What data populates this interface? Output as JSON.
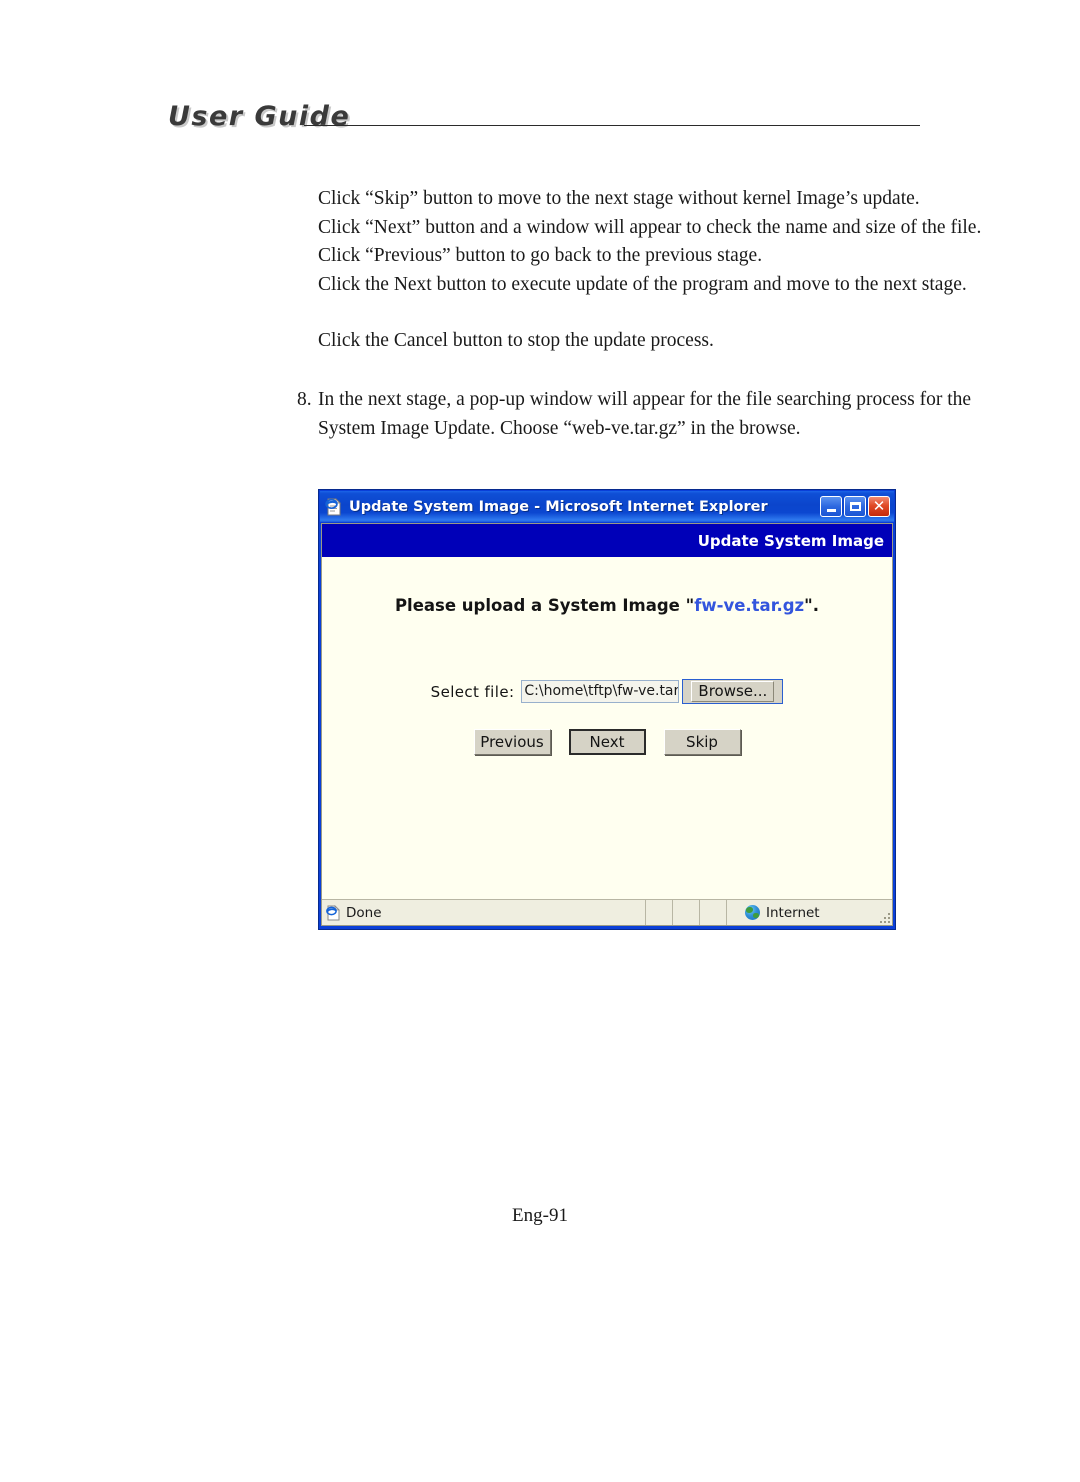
{
  "header": {
    "guide_title": "User Guide"
  },
  "body": {
    "paragraphs": [
      "Click “Skip” button to move to the next stage without kernel Image’s update.",
      "Click “Next” button and a window will appear to check the name and size of the file.",
      "Click “Previous” button to go back to the previous stage.",
      "Click the Next button to execute update of the program and move to the next stage.",
      "Click the Cancel button to stop the update process."
    ],
    "numbered_item": {
      "number": "8.",
      "line1": "In the next stage, a pop-up window will appear for the file searching process for the",
      "line2": "System Image Update. Choose “web-ve.tar.gz” in the browse."
    }
  },
  "browser": {
    "titlebar": {
      "icon": "ie-document-icon",
      "title": "Update System Image - Microsoft Internet Explorer",
      "minimize_label": "Minimize",
      "maximize_label": "Maximize",
      "close_label": "Close"
    },
    "app_bar": {
      "title": "Update System Image"
    },
    "content": {
      "heading_prefix": "Please upload a System Image \"",
      "heading_filename": "fw-ve.tar.gz",
      "heading_suffix": "\".",
      "file_label": "Select file:",
      "file_value": "C:\\home\\tftp\\fw-ve.tar.gz",
      "browse_label": "Browse...",
      "buttons": [
        {
          "label": "Previous",
          "default": false
        },
        {
          "label": "Next",
          "default": true
        },
        {
          "label": "Skip",
          "default": false
        }
      ]
    },
    "statusbar": {
      "status_text": "Done",
      "zone_text": "Internet",
      "zone_icon": "globe-icon",
      "doc_icon": "ie-document-icon"
    }
  },
  "footer": {
    "page_number": "Eng-91"
  },
  "colors": {
    "title_bar_blue": "#0b45cc",
    "app_bar_blue": "#0000b8",
    "content_cream": "#fffff0",
    "filename_blue": "#3355dd",
    "close_red": "#c5290b"
  }
}
